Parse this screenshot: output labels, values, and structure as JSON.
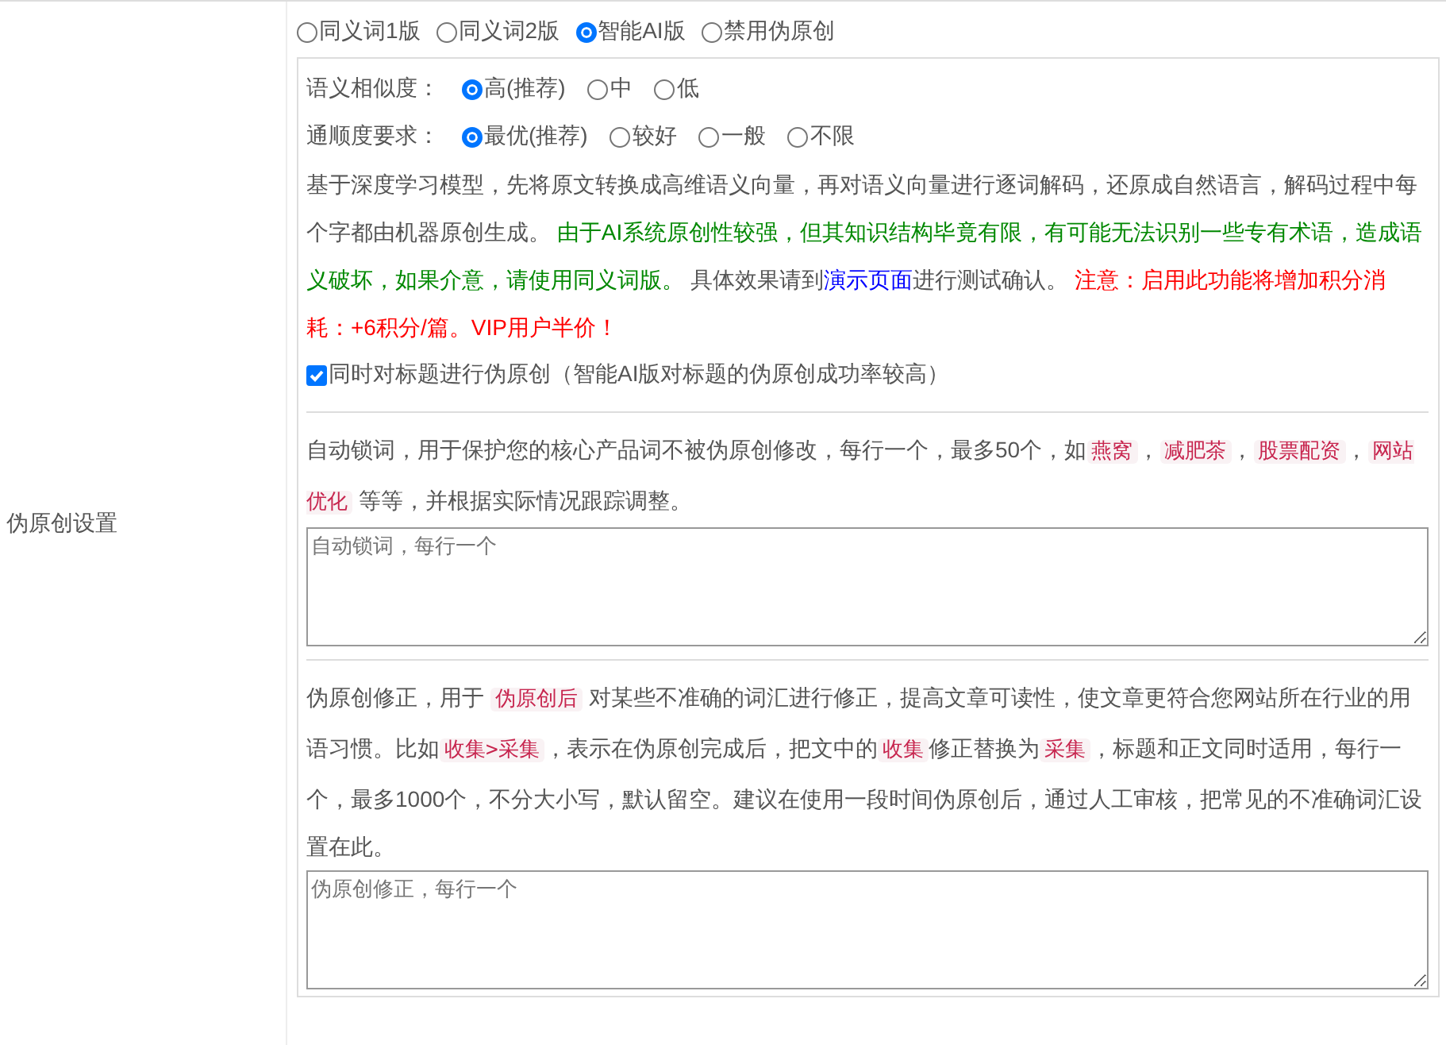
{
  "label": "伪原创设置",
  "modes": [
    {
      "label": "同义词1版",
      "selected": false
    },
    {
      "label": "同义词2版",
      "selected": false
    },
    {
      "label": "智能AI版",
      "selected": true
    },
    {
      "label": "禁用伪原创",
      "selected": false
    }
  ],
  "option_groups": [
    {
      "label": "语义相似度：",
      "options": [
        {
          "label": "高(推荐)",
          "selected": true
        },
        {
          "label": "中",
          "selected": false
        },
        {
          "label": "低",
          "selected": false
        }
      ]
    },
    {
      "label": "通顺度要求：",
      "options": [
        {
          "label": "最优(推荐)",
          "selected": true
        },
        {
          "label": "较好",
          "selected": false
        },
        {
          "label": "一般",
          "selected": false
        },
        {
          "label": "不限",
          "selected": false
        }
      ]
    }
  ],
  "ai_description": [
    {
      "kind": "text",
      "text": "基于深度学习模型，先将原文转换成高维语义向量，再对语义向量进行逐词解码，还原成自然语言，解码过程中每个字都由机器原创生成。 "
    },
    {
      "kind": "note",
      "text": "由于AI系统原创性较强，但其知识结构毕竟有限，有可能无法识别一些专有术语，造成语义破坏，如果介意，请使用同义词版。"
    },
    {
      "kind": "text",
      "text": " 具体效果请到"
    },
    {
      "kind": "link",
      "text": "演示页面"
    },
    {
      "kind": "text",
      "text": "进行测试确认。 "
    },
    {
      "kind": "warning",
      "text": "注意：启用此功能将增加积分消耗：+6积分/篇。VIP用户半价！"
    }
  ],
  "title_option": {
    "label": "同时对标题进行伪原创（智能AI版对标题的伪原创成功率较高）",
    "checked": true
  },
  "sections": [
    {
      "description": [
        {
          "kind": "text",
          "text": "自动锁词，用于保护您的核心产品词不被伪原创修改，每行一个，最多50个，如"
        },
        {
          "kind": "code",
          "text": "燕窝"
        },
        {
          "kind": "text",
          "text": "，"
        },
        {
          "kind": "code",
          "text": "减肥茶"
        },
        {
          "kind": "text",
          "text": "，"
        },
        {
          "kind": "code",
          "text": "股票配资"
        },
        {
          "kind": "text",
          "text": "，"
        },
        {
          "kind": "code",
          "text": "网站优化"
        },
        {
          "kind": "text",
          "text": " 等等，并根据实际情况跟踪调整。"
        }
      ],
      "placeholder": "自动锁词，每行一个"
    },
    {
      "description": [
        {
          "kind": "text",
          "text": "伪原创修正，用于 "
        },
        {
          "kind": "code",
          "text": "伪原创后"
        },
        {
          "kind": "text",
          "text": " 对某些不准确的词汇进行修正，提高文章可读性，使文章更符合您网站所在行业的用语习惯。比如"
        },
        {
          "kind": "code",
          "text": "收集>采集"
        },
        {
          "kind": "text",
          "text": "，表示在伪原创完成后，把文中的"
        },
        {
          "kind": "code",
          "text": "收集"
        },
        {
          "kind": "text",
          "text": "修正替换为"
        },
        {
          "kind": "code",
          "text": "采集"
        },
        {
          "kind": "text",
          "text": "，标题和正文同时适用，每行一个，最多1000个，不分大小写，默认留空。建议在使用一段时间伪原创后，通过人工审核，把常见的不准确词汇设置在此。"
        }
      ],
      "placeholder": "伪原创修正，每行一个"
    }
  ]
}
